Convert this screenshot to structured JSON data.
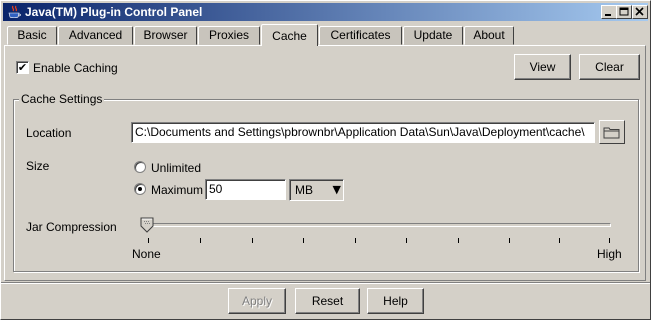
{
  "window": {
    "title": "Java(TM) Plug-in Control Panel"
  },
  "tabs": [
    {
      "label": "Basic"
    },
    {
      "label": "Advanced"
    },
    {
      "label": "Browser"
    },
    {
      "label": "Proxies"
    },
    {
      "label": "Cache",
      "active": true
    },
    {
      "label": "Certificates"
    },
    {
      "label": "Update"
    },
    {
      "label": "About"
    }
  ],
  "cache": {
    "enable_caching": {
      "label": "Enable Caching",
      "checked": true
    },
    "view_label": "View",
    "clear_label": "Clear",
    "settings": {
      "title": "Cache Settings",
      "location_label": "Location",
      "location_value": "C:\\Documents and Settings\\pbrownbr\\Application Data\\Sun\\Java\\Deployment\\cache\\",
      "size_label": "Size",
      "unlimited_label": "Unlimited",
      "maximum_label": "Maximum",
      "maximum_value": "50",
      "unit": "MB",
      "jar_label": "Jar Compression",
      "none_label": "None",
      "high_label": "High",
      "compression_level": 0
    }
  },
  "footer": {
    "apply_label": "Apply",
    "reset_label": "Reset",
    "help_label": "Help"
  }
}
